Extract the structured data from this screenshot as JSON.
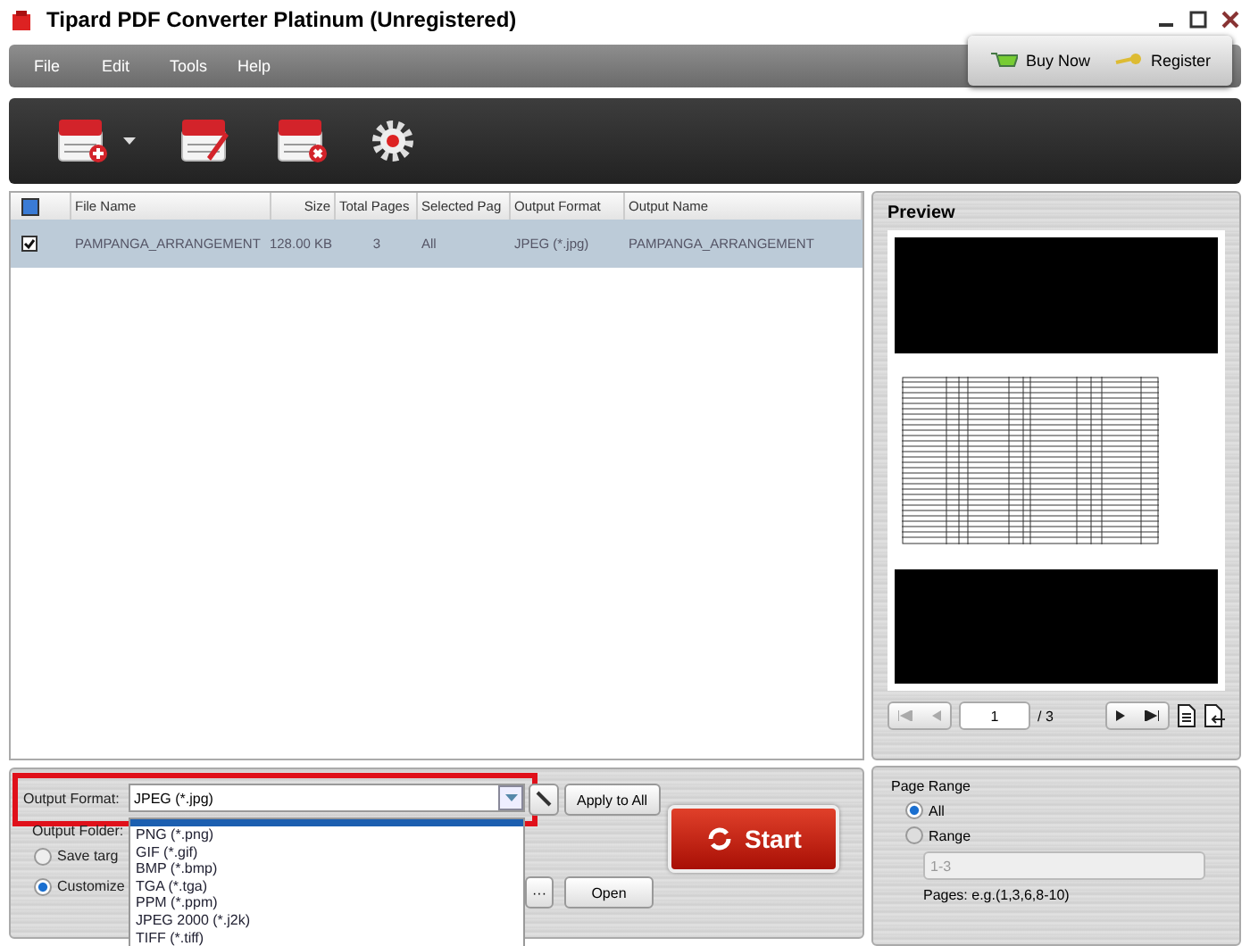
{
  "window": {
    "title": "Tipard PDF Converter Platinum (Unregistered)"
  },
  "menu": [
    "File",
    "Edit",
    "Tools",
    "Help"
  ],
  "header_buttons": [
    {
      "label": "Buy Now",
      "kind": "buy"
    },
    {
      "label": "Register",
      "kind": "register"
    }
  ],
  "table": {
    "header_checked": true,
    "columns": [
      "File Name",
      "Size",
      "Total Pages",
      "Selected Pag",
      "Output Format",
      "Output Name"
    ],
    "rows": [
      {
        "checked": true,
        "selected": true,
        "cells": [
          "PAMPANGA_ARRANGEMENT",
          "128.00 KB",
          "3",
          "All",
          "JPEG (*.jpg)",
          "PAMPANGA_ARRANGEMENT"
        ]
      }
    ]
  },
  "output_format": {
    "label": "Output Format:",
    "value": "JPEG (*.jpg)",
    "options": [
      "PNG (*.png)",
      "GIF (*.gif)",
      "BMP (*.bmp)",
      "TGA (*.tga)",
      "PPM (*.ppm)",
      "JPEG 2000 (*.j2k)",
      "TIFF (*.tiff)"
    ]
  },
  "apply_all": "Apply to All",
  "output_folder": {
    "label": "Output Folder:",
    "options": [
      {
        "label": "Save targ",
        "selected": false
      },
      {
        "label": "Customize",
        "selected": true
      }
    ],
    "browse": "···",
    "open": "Open"
  },
  "start": "Start",
  "preview": {
    "title": "Preview",
    "page": "1",
    "total": "/ 3"
  },
  "page_range": {
    "title": "Page Range",
    "options": [
      {
        "label": "All",
        "selected": true
      },
      {
        "label": "Range",
        "selected": false
      }
    ],
    "range_value": "1-3",
    "range_disabled": true,
    "hint": "Pages: e.g.(1,3,6,8-10)"
  }
}
